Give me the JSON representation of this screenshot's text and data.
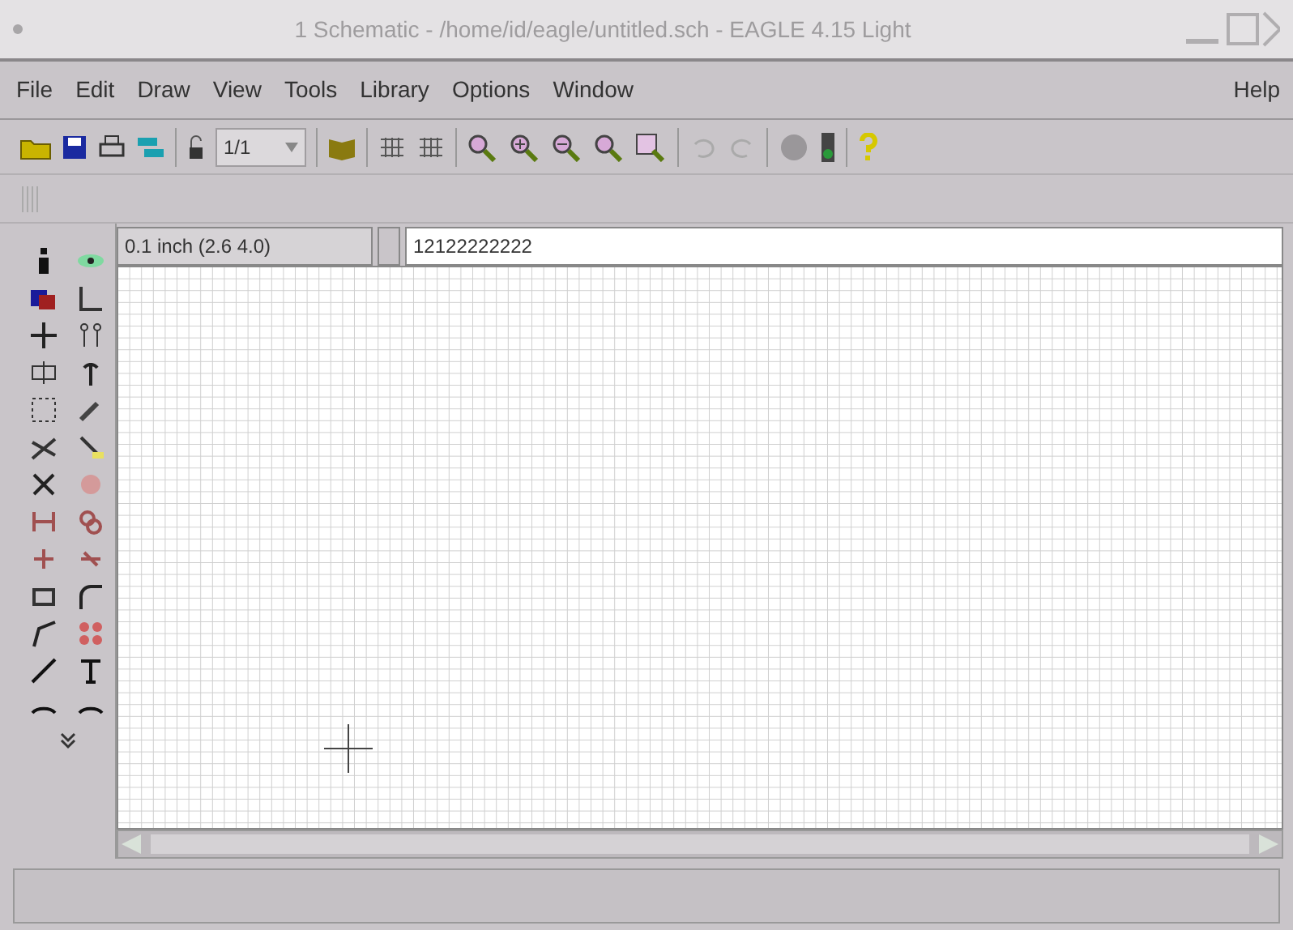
{
  "window": {
    "title": "1 Schematic - /home/id/eagle/untitled.sch - EAGLE 4.15 Light"
  },
  "menu": [
    {
      "label": "File"
    },
    {
      "label": "Edit"
    },
    {
      "label": "Draw"
    },
    {
      "label": "View"
    },
    {
      "label": "Tools"
    },
    {
      "label": "Library"
    },
    {
      "label": "Options"
    },
    {
      "label": "Window"
    }
  ],
  "help_menu": {
    "label": "Help"
  },
  "toolbar": {
    "sheet_combo": {
      "value": "1/1"
    }
  },
  "coordinate_display": "0.1 inch (2.6 4.0)",
  "command_field": {
    "value": "12122222222"
  }
}
